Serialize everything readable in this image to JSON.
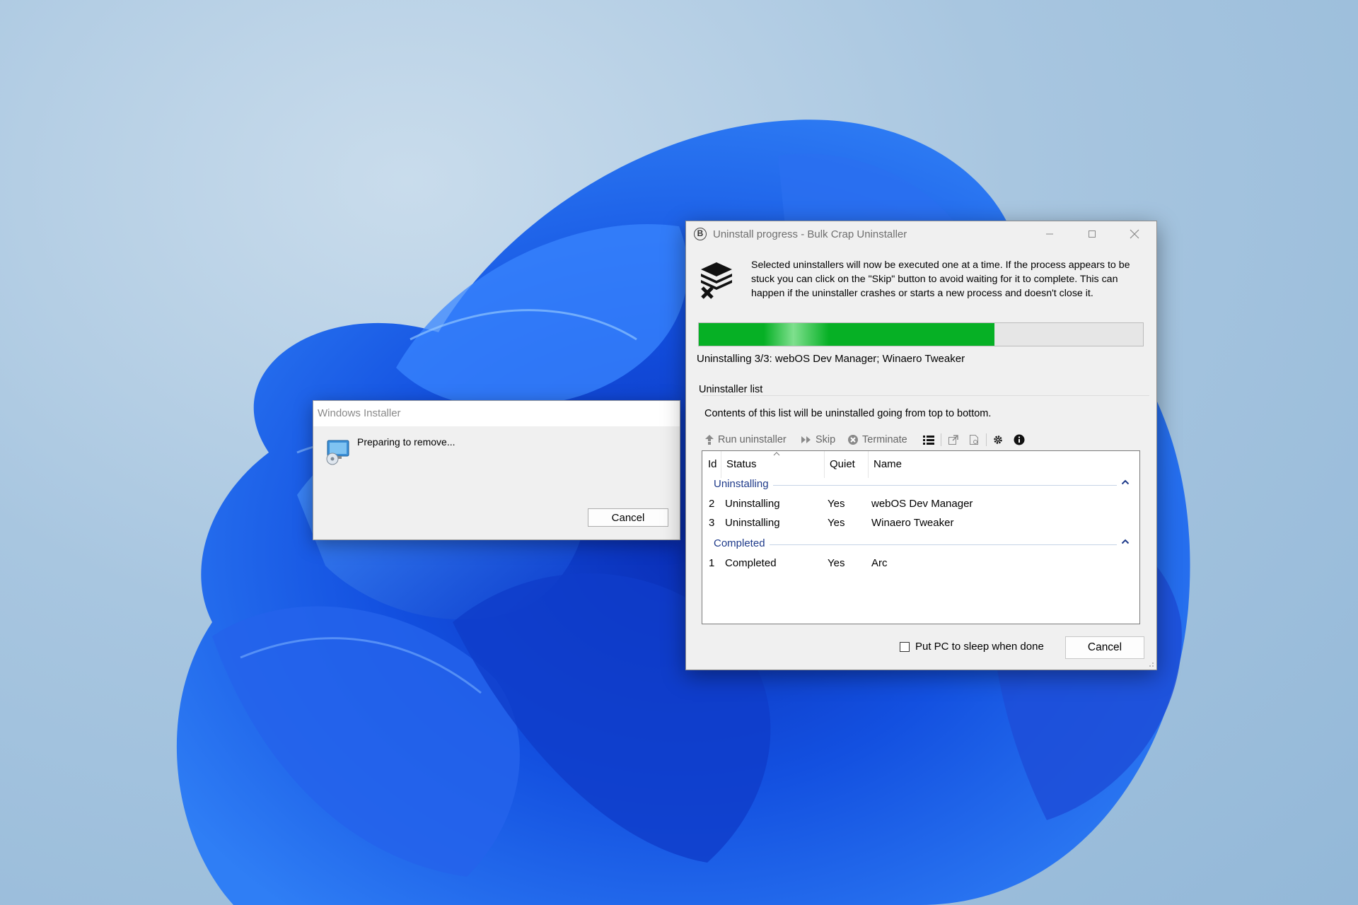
{
  "windows_installer": {
    "title": "Windows Installer",
    "message": "Preparing to remove...",
    "cancel_label": "Cancel"
  },
  "bcu": {
    "title": "Uninstall progress - Bulk Crap Uninstaller",
    "description": "Selected uninstallers will now be executed one at a time. If the process appears to be stuck you can click on the \"Skip\" button to avoid waiting for it to complete. This can happen if the uninstaller crashes or starts a new process and doesn't close it.",
    "progress_fraction": 0.665,
    "status_text": "Uninstalling 3/3: webOS Dev Manager; Winaero Tweaker",
    "group_label": "Uninstaller list",
    "list_description": "Contents of this list will be uninstalled going from top to bottom.",
    "toolbar": {
      "run_uninstaller": "Run uninstaller",
      "skip": "Skip",
      "terminate": "Terminate"
    },
    "columns": {
      "id": "Id",
      "status": "Status",
      "quiet": "Quiet",
      "name": "Name"
    },
    "groups": [
      {
        "name": "Uninstalling",
        "rows": [
          {
            "id": "2",
            "status": "Uninstalling",
            "quiet": "Yes",
            "name": "webOS Dev Manager"
          },
          {
            "id": "3",
            "status": "Uninstalling",
            "quiet": "Yes",
            "name": "Winaero Tweaker"
          }
        ]
      },
      {
        "name": "Completed",
        "rows": [
          {
            "id": "1",
            "status": "Completed",
            "quiet": "Yes",
            "name": "Arc"
          }
        ]
      }
    ],
    "sleep_label": "Put PC to sleep when done",
    "sleep_checked": false,
    "cancel_label": "Cancel",
    "accent_progress": "#06b025",
    "group_header_color": "#1e3a8a"
  }
}
